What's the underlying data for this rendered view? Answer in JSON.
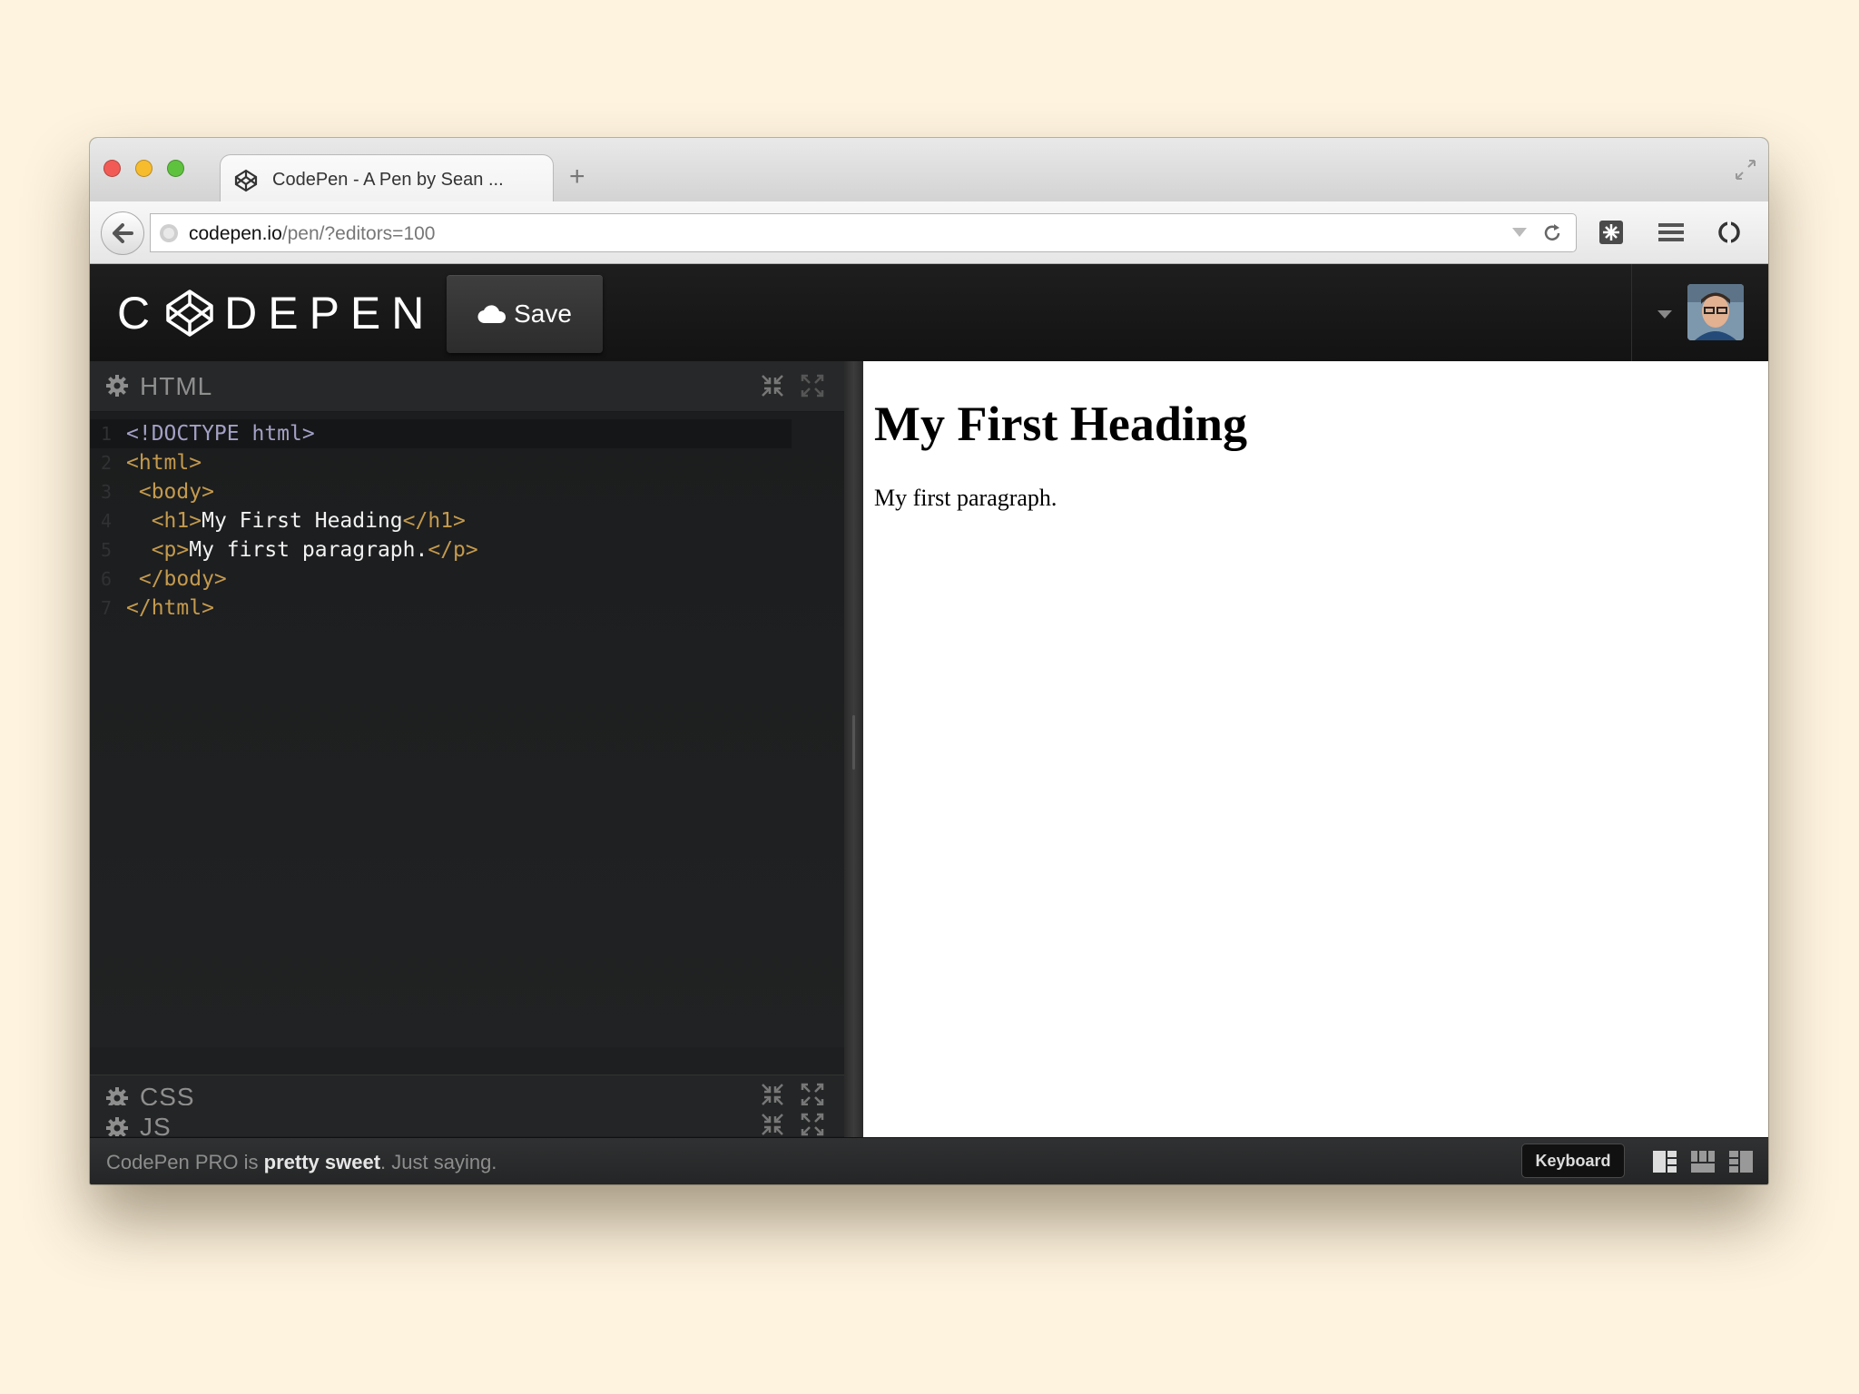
{
  "browser": {
    "tab_title": "CodePen - A Pen by Sean ...",
    "new_tab_label": "+",
    "url_host": "codepen.io",
    "url_path": "/pen/?editors=100"
  },
  "header": {
    "logo_text_left": "C",
    "logo_text_right": "DEPEN",
    "save_label": "Save"
  },
  "editor": {
    "html_title": "HTML",
    "css_title": "CSS",
    "js_title": "JS",
    "error_symbol": "!",
    "lines": [
      {
        "n": "1",
        "parts": [
          {
            "c": "doctype",
            "t": "<!DOCTYPE html>"
          }
        ]
      },
      {
        "n": "2",
        "parts": [
          {
            "c": "tag",
            "t": "<html>"
          }
        ]
      },
      {
        "n": "3",
        "parts": [
          {
            "c": "tag",
            "t": " <body>"
          }
        ]
      },
      {
        "n": "4",
        "parts": [
          {
            "c": "tag",
            "t": "  <h1>"
          },
          {
            "c": "txt",
            "t": "My First Heading"
          },
          {
            "c": "tag",
            "t": "</h1>"
          }
        ]
      },
      {
        "n": "5",
        "parts": [
          {
            "c": "tag",
            "t": "  <p>"
          },
          {
            "c": "txt",
            "t": "My first paragraph."
          },
          {
            "c": "tag",
            "t": "</p>"
          }
        ]
      },
      {
        "n": "6",
        "parts": [
          {
            "c": "tag",
            "t": " </body>"
          }
        ]
      },
      {
        "n": "7",
        "parts": [
          {
            "c": "tag",
            "t": "</html>"
          }
        ]
      }
    ]
  },
  "preview": {
    "heading": "My First Heading",
    "paragraph": "My first paragraph."
  },
  "footer": {
    "promo_a": "CodePen PRO is ",
    "promo_b": "pretty sweet",
    "promo_c": ". Just saying.",
    "keyboard_label": "Keyboard"
  },
  "colors": {
    "tag": "#c49a4d",
    "doctype": "#a3a0c6",
    "text": "#f2f2f2",
    "error": "#e01010"
  }
}
